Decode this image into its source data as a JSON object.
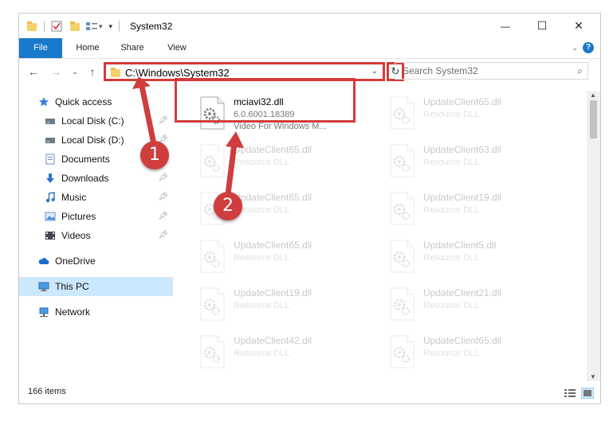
{
  "window": {
    "title": "System32",
    "controls": {
      "minimize": "—",
      "maximize": "☐",
      "close": "✕"
    }
  },
  "ribbon": {
    "tabs": [
      "File",
      "Home",
      "Share",
      "View"
    ],
    "help": "?"
  },
  "nav": {
    "address": "C:\\Windows\\System32",
    "search_placeholder": "Search System32"
  },
  "sidebar": {
    "items": [
      {
        "label": "Quick access",
        "icon": "star-icon",
        "pinned": false
      },
      {
        "label": "Local Disk (C:)",
        "icon": "drive-icon",
        "pinned": true
      },
      {
        "label": "Local Disk (D:)",
        "icon": "drive-icon",
        "pinned": true
      },
      {
        "label": "Documents",
        "icon": "documents-icon",
        "pinned": true
      },
      {
        "label": "Downloads",
        "icon": "download-icon",
        "pinned": true
      },
      {
        "label": "Music",
        "icon": "music-icon",
        "pinned": true
      },
      {
        "label": "Pictures",
        "icon": "pictures-icon",
        "pinned": true
      },
      {
        "label": "Videos",
        "icon": "videos-icon",
        "pinned": true
      },
      {
        "label": "OneDrive",
        "icon": "cloud-icon",
        "pinned": false
      },
      {
        "label": "This PC",
        "icon": "pc-icon",
        "pinned": false,
        "selected": true
      },
      {
        "label": "Network",
        "icon": "network-icon",
        "pinned": false
      }
    ]
  },
  "files": {
    "highlighted": {
      "name": "mciavi32.dll",
      "version": "6.0.6001.18389",
      "description": "Video For Windows M..."
    },
    "left_column": [
      {
        "name": "UpdateClient65.dll",
        "type": "Resource DLL"
      },
      {
        "name": "UpdateClient65.dll",
        "type": "Resource DLL"
      },
      {
        "name": "UpdateClient65.dll",
        "type": "Resource DLL"
      },
      {
        "name": "UpdateClient19.dll",
        "type": "Resource DLL"
      },
      {
        "name": "UpdateClient42.dll",
        "type": "Resource DLL"
      }
    ],
    "right_column": [
      {
        "name": "UpdateClient65.dll",
        "type": "Resource DLL"
      },
      {
        "name": "UpdateClient63.dll",
        "type": "Resource DLL"
      },
      {
        "name": "UpdateClient19.dll",
        "type": "Resource DLL"
      },
      {
        "name": "UpdateClient5.dll",
        "type": "Resource DLL"
      },
      {
        "name": "UpdateClient21.dll",
        "type": "Resource DLL"
      },
      {
        "name": "UpdateClient65.dll",
        "type": "Resource DLL"
      }
    ]
  },
  "status": {
    "count": "166 items"
  },
  "callouts": [
    "1",
    "2"
  ],
  "colors": {
    "accent": "#1979ca",
    "highlight": "#d63a3a",
    "selection": "#cce8ff"
  }
}
